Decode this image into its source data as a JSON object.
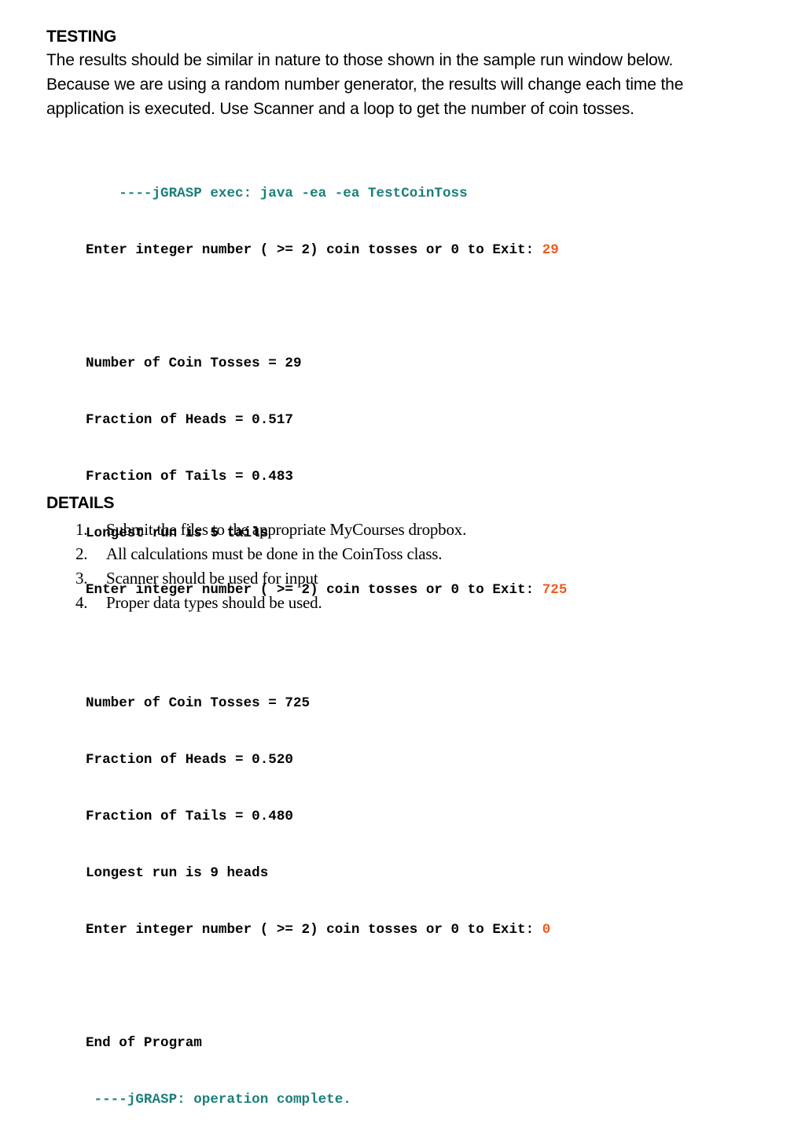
{
  "testing": {
    "heading": "TESTING",
    "lines": [
      "The results should be similar in nature to those shown in the sample run window below.",
      "Because we are using a random number generator, the results will change each time the",
      "application is executed. Use Scanner and a loop to get the number of coin tosses."
    ]
  },
  "console": {
    "colors": {
      "system": "#1a7f7b",
      "input": "#f05a1e",
      "output": "#000000"
    },
    "exec_line": "----jGRASP exec: java -ea -ea TestCoinToss",
    "prompt": "Enter integer number ( >= 2) coin tosses or 0 to Exit: ",
    "runs": [
      {
        "input": "29",
        "tosses_line": "Number of Coin Tosses = 29",
        "heads_line": "Fraction of Heads = 0.517",
        "tails_line": "Fraction of Tails = 0.483",
        "run_line": "Longest run is 5 tails"
      },
      {
        "input": "725",
        "tosses_line": "Number of Coin Tosses = 725",
        "heads_line": "Fraction of Heads = 0.520",
        "tails_line": "Fraction of Tails = 0.480",
        "run_line": "Longest run is 9 heads"
      }
    ],
    "exit_input": "0",
    "end_line": "End of Program",
    "complete_line": " ----jGRASP: operation complete."
  },
  "details": {
    "heading": "DETAILS",
    "items": [
      {
        "num": "1.",
        "text": "Submit the files to the appropriate MyCourses dropbox."
      },
      {
        "num": "2.",
        "text": "All calculations must be done in the CoinToss class."
      },
      {
        "num": "3.",
        "text": "Scanner should be used for input"
      },
      {
        "num": "4.",
        "text": "Proper data types should be used."
      }
    ]
  }
}
